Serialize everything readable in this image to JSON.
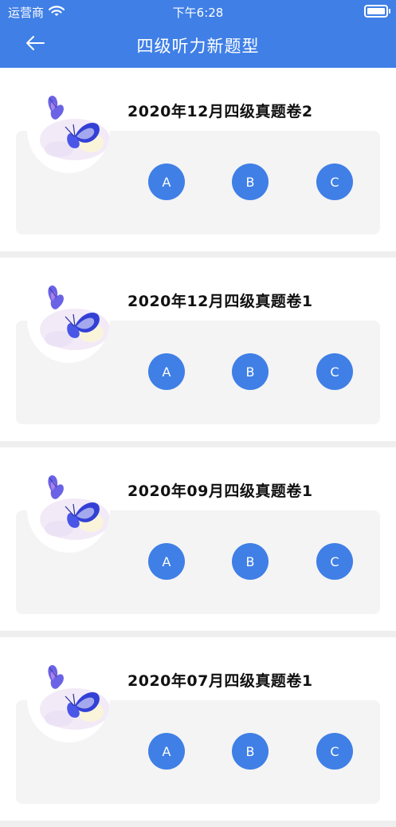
{
  "status": {
    "carrier": "运营商",
    "time": "下午6:28"
  },
  "nav": {
    "title": "四级听力新题型"
  },
  "papers": [
    {
      "title": "2020年12月四级真题卷2",
      "options": [
        "A",
        "B",
        "C"
      ]
    },
    {
      "title": "2020年12月四级真题卷1",
      "options": [
        "A",
        "B",
        "C"
      ]
    },
    {
      "title": "2020年09月四级真题卷1",
      "options": [
        "A",
        "B",
        "C"
      ]
    },
    {
      "title": "2020年07月四级真题卷1",
      "options": [
        "A",
        "B",
        "C"
      ]
    }
  ],
  "colors": {
    "accent": "#3f7fe6",
    "panel": "#f4f4f4",
    "background": "#efefef"
  },
  "icons": {
    "back": "arrow-left-icon",
    "wifi": "wifi-icon",
    "battery": "battery-icon",
    "thumbnail": "butterfly-icon"
  }
}
